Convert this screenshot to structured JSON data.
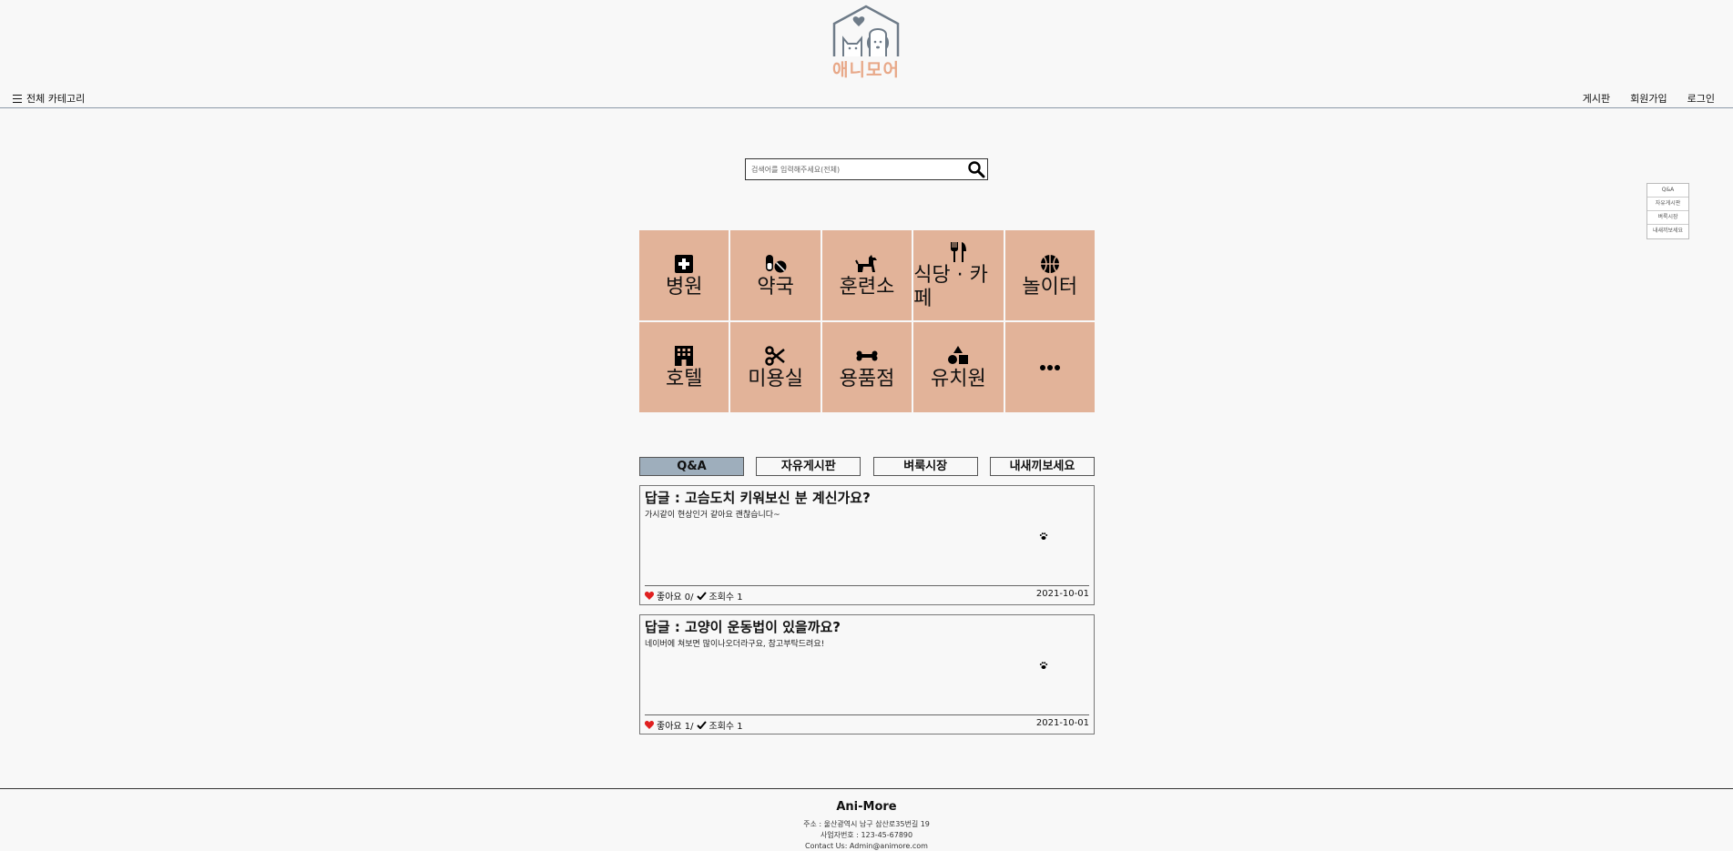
{
  "header": {
    "logo_text": "애니모어",
    "menu_label": "전체 카테고리",
    "links": [
      "게시판",
      "회원가입",
      "로그인"
    ]
  },
  "search": {
    "placeholder": "검색어를 입력해주세요(전체)"
  },
  "quick_menu": [
    "Q&A",
    "자유게시판",
    "벼룩시장",
    "내새끼보세요"
  ],
  "categories": [
    {
      "label": "병원",
      "icon": "first-aid-icon"
    },
    {
      "label": "약국",
      "icon": "pills-icon"
    },
    {
      "label": "훈련소",
      "icon": "dog-icon"
    },
    {
      "label": "식당 · 카페",
      "icon": "utensils-icon"
    },
    {
      "label": "놀이터",
      "icon": "basketball-icon"
    },
    {
      "label": "호텔",
      "icon": "hotel-icon"
    },
    {
      "label": "미용실",
      "icon": "scissors-icon"
    },
    {
      "label": "용품점",
      "icon": "bone-icon"
    },
    {
      "label": "유치원",
      "icon": "shapes-icon"
    },
    {
      "label": "",
      "icon": "ellipsis-icon"
    }
  ],
  "tabs": [
    {
      "label": "Q&A",
      "active": true
    },
    {
      "label": "자유게시판",
      "active": false
    },
    {
      "label": "벼룩시장",
      "active": false
    },
    {
      "label": "내새끼보세요",
      "active": false
    }
  ],
  "posts": [
    {
      "title": "답글 : 고슴도치 키워보신 분 계신가요?",
      "body": "가시같이 현상인거 같아요 괜찮습니다~",
      "likes": "좋아요 0/",
      "views": "조회수 1",
      "date": "2021-10-01"
    },
    {
      "title": "답글 : 고양이 운동법이 있을까요?",
      "body": "네이버에 쳐보면 많이나오더라구요, 참고부탁드려요!",
      "likes": "좋아요 1/",
      "views": "조회수 1",
      "date": "2021-10-01"
    }
  ],
  "footer": {
    "brand": "Ani-More",
    "address": "주소 : 울산광역시 남구 삼산로35번길 19",
    "business_no": "사업자번호 : 123-45-67890",
    "contact": "Contact Us: Admin@animore.com"
  },
  "colors": {
    "category_bg": "#e2b399",
    "active_tab": "#9eaebc",
    "logo_accent": "#e8a888",
    "heart": "#e02020"
  }
}
